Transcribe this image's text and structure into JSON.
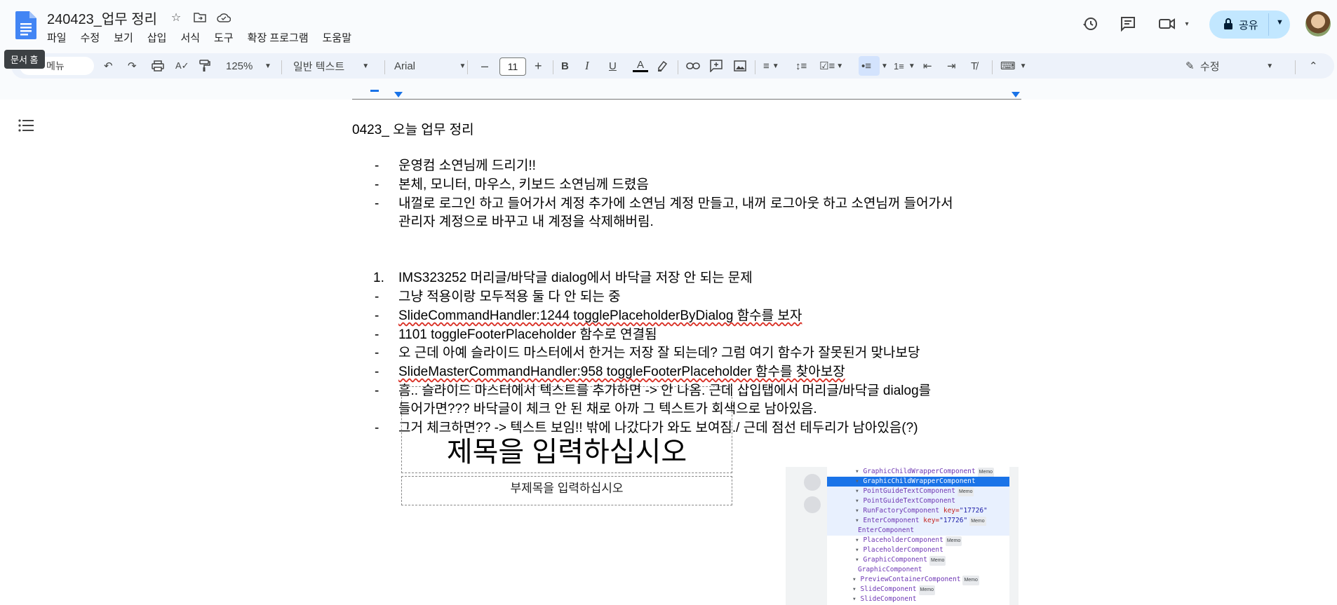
{
  "app": {
    "doc_title": "240423_업무 정리",
    "menus": [
      "파일",
      "수정",
      "보기",
      "삽입",
      "서식",
      "도구",
      "확장 프로그램",
      "도움말"
    ],
    "tooltip": "문서 홈",
    "share_label": "공유"
  },
  "toolbar": {
    "search_placeholder": "메뉴",
    "zoom": "125%",
    "style": "일반 텍스트",
    "font": "Arial",
    "font_size": "11",
    "mode": "수정"
  },
  "doc": {
    "heading": "0423_ 오늘 업무 정리",
    "lines": [
      {
        "marker": "-",
        "text": "운영컴 소연님께 드리기!!"
      },
      {
        "marker": "-",
        "text": "본체, 모니터, 마우스, 키보드 소연님께 드렸음"
      },
      {
        "marker": "-",
        "text": "내껄로 로그인 하고 들어가서 계정 추가에 소연님 계정 만들고, 내꺼 로그아웃 하고 소연님꺼 들어가서"
      },
      {
        "marker": "",
        "text": "관리자 계정으로 바꾸고 내 계정을 삭제해버림."
      },
      {
        "marker": "1.",
        "text": "IMS323252 머리글/바닥글 dialog에서 바닥글 저장 안 되는 문제"
      },
      {
        "marker": "-",
        "text": "그냥 적용이랑 모두적용 둘 다 안 되는 중"
      },
      {
        "marker": "-",
        "text": "SlideCommandHandler:1244 togglePlaceholderByDialog 함수를 보자"
      },
      {
        "marker": "-",
        "text": "1101 toggleFooterPlaceholder 함수로 연결됨"
      },
      {
        "marker": "-",
        "text": "오 근데 아예 슬라이드 마스터에서 한거는 저장 잘 되는데? 그럼 여기 함수가 잘못된거 맞나보당"
      },
      {
        "marker": "-",
        "text": "SlideMasterCommandHandler:958 toggleFooterPlaceholder 함수를 찾아보장"
      },
      {
        "marker": "-",
        "text": "흠.. 슬라이드 마스터에서 텍스트를 추가하면 -> 안 나옴. 근데 삽입탭에서 머리글/바닥글 dialog를"
      },
      {
        "marker": "",
        "text": "들어가면??? 바닥글이 체크 안 된 채로 아까 그 텍스트가 회색으로 남아있음."
      },
      {
        "marker": "-",
        "text": "그거 체크하면?? -> 텍스트 보임!! 밖에 나갔다가 와도 보여짐./ 근데 점선 테두리가 남아있음(?)"
      }
    ],
    "slide_title": "제목을 입력하십시오",
    "slide_subtitle": "부제목을 입력하십시오",
    "devtools_rows": [
      {
        "name": "GraphicChildWrapperComponent",
        "memo": "Memo",
        "indent": 0
      },
      {
        "name": "GraphicChildWrapperComponent",
        "memo": "",
        "indent": 0,
        "selected": true
      },
      {
        "name": "PointGuideTextComponent",
        "memo": "Memo",
        "indent": 0
      },
      {
        "name": "PointGuideTextComponent",
        "memo": "",
        "indent": 0
      },
      {
        "name": "RunFactoryComponent",
        "attr": "key",
        "value": "\"17726\"",
        "memo": "",
        "indent": 0
      },
      {
        "name": "EnterComponent",
        "attr": "key",
        "value": "\"17726\"",
        "memo": "Memo",
        "indent": 0
      },
      {
        "name": "EnterComponent",
        "memo": "",
        "indent": 1
      },
      {
        "name": "PlaceholderComponent",
        "memo": "Memo",
        "indent": 0
      },
      {
        "name": "PlaceholderComponent",
        "memo": "",
        "indent": 0
      },
      {
        "name": "GraphicComponent",
        "memo": "Memo",
        "indent": 0
      },
      {
        "name": "GraphicComponent",
        "memo": "",
        "indent": 1
      },
      {
        "name": "PreviewContainerComponent",
        "memo": "Memo",
        "indent": -1
      },
      {
        "name": "SlideComponent",
        "memo": "Memo",
        "indent": -1
      },
      {
        "name": "SlideComponent",
        "memo": "",
        "indent": -1
      }
    ]
  },
  "colors": {
    "accent": "#1a73e8",
    "share_bg": "#c2e7ff",
    "toolbar_bg": "#edf2fa",
    "spell_error": "#d93025"
  }
}
